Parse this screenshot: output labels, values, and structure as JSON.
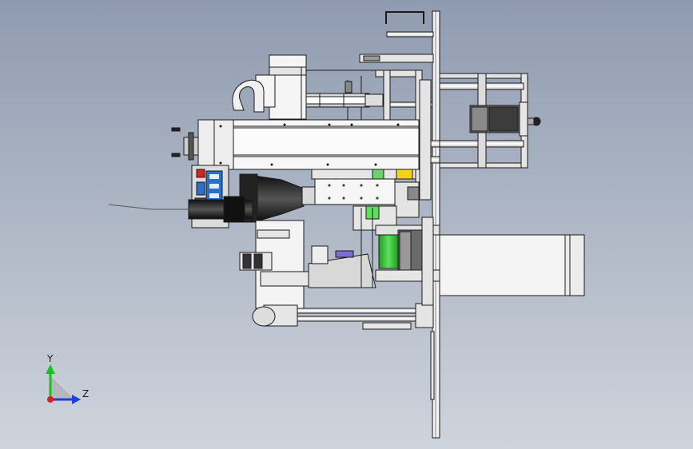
{
  "viewport": {
    "background_top": "#8f9bb0",
    "background_bottom": "#cfd4dc",
    "model_line_color": "#1a1a1a",
    "model_face_color": "#f2f2f2"
  },
  "triad": {
    "y_label": "Y",
    "z_label": "Z",
    "y_color": "#19c21f",
    "z_color": "#1f3fd6",
    "x_color": "#d61f1f"
  },
  "accents": {
    "green_part": "#33cc33",
    "yellow_part": "#f2d21a",
    "red_part": "#e02020",
    "blue_part": "#2a6fc9",
    "purple_part": "#7a6fd0"
  }
}
